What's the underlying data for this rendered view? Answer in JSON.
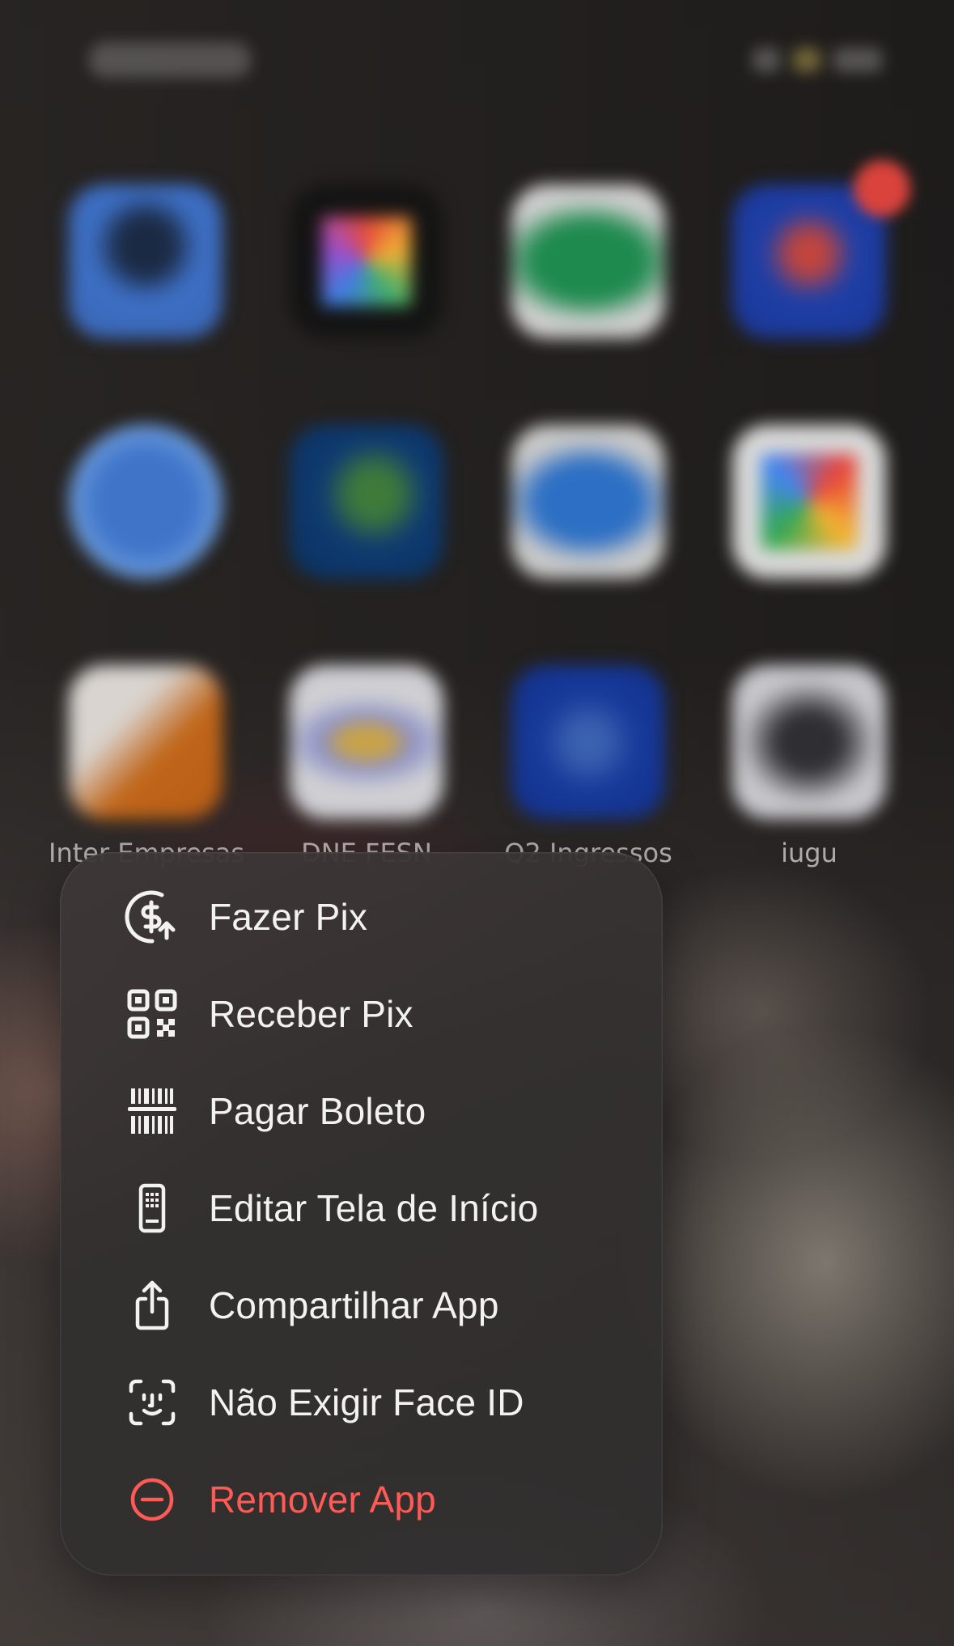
{
  "home_screen": {
    "visible_app_labels": [
      "Inter Empresas",
      "DNE FESN",
      "Q2 Ingressos",
      "iugu"
    ]
  },
  "context_menu": {
    "items": [
      {
        "label": "Fazer Pix",
        "icon": "pix-send-icon"
      },
      {
        "label": "Receber Pix",
        "icon": "qr-code-icon"
      },
      {
        "label": "Pagar Boleto",
        "icon": "barcode-icon"
      },
      {
        "label": "Editar Tela de Início",
        "icon": "phone-icon"
      },
      {
        "label": "Compartilhar App",
        "icon": "share-icon"
      },
      {
        "label": "Não Exigir Face ID",
        "icon": "face-id-icon"
      },
      {
        "label": "Remover App",
        "icon": "minus-circle-icon",
        "destructive": true
      }
    ]
  },
  "colors": {
    "menu_text": "#f2f2f2",
    "destructive": "#ff5a55",
    "badge": "#d9433c"
  }
}
